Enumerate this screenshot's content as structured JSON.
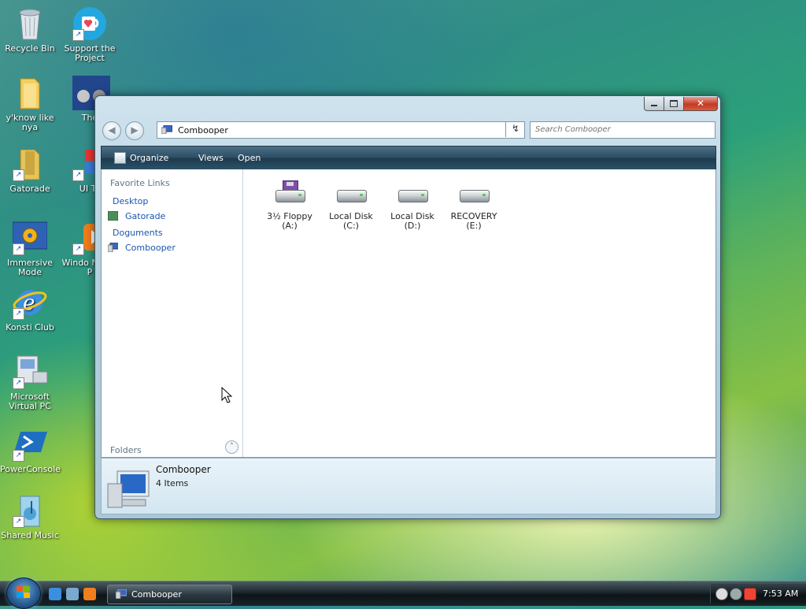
{
  "desktop": {
    "icons": [
      {
        "label": "Recycle Bin",
        "icon": "recycle-bin-icon"
      },
      {
        "label": "Support the Project",
        "icon": "heart-mug-icon"
      },
      {
        "label": "y'know like nya",
        "icon": "folder-icon"
      },
      {
        "label": "The",
        "icon": "cat-image-icon"
      },
      {
        "label": "Gatorade",
        "icon": "shortcut-icon"
      },
      {
        "label": "UI Te",
        "icon": "shortcut-icon"
      },
      {
        "label": "Immersive Mode",
        "icon": "settings-gear-icon"
      },
      {
        "label": "Windo Media P",
        "icon": "media-player-icon"
      },
      {
        "label": "Konsti Club",
        "icon": "internet-explorer-icon"
      },
      {
        "label": "Microsoft Virtual PC",
        "icon": "virtual-pc-icon"
      },
      {
        "label": "PowerConsole",
        "icon": "powershell-icon"
      },
      {
        "label": "Shared Music",
        "icon": "music-folder-icon"
      }
    ]
  },
  "window": {
    "address": "Combooper",
    "search_placeholder": "Search Combooper",
    "toolbar": {
      "organize": "Organize",
      "views": "Views",
      "open": "Open"
    },
    "nav": {
      "header": "Favorite Links",
      "links": [
        {
          "label": "Desktop"
        },
        {
          "label": "Gatorade"
        },
        {
          "label": "Doguments"
        },
        {
          "label": "Combooper"
        }
      ],
      "folders": "Folders"
    },
    "drives": [
      {
        "name": "3½ Floppy",
        "letter": "(A:)",
        "icon": "floppy-drive-icon"
      },
      {
        "name": "Local Disk",
        "letter": "(C:)",
        "icon": "hard-disk-icon"
      },
      {
        "name": "Local Disk",
        "letter": "(D:)",
        "icon": "hard-disk-icon"
      },
      {
        "name": "RECOVERY",
        "letter": "(E:)",
        "icon": "hard-disk-icon"
      }
    ],
    "details": {
      "name": "Combooper",
      "count": "4 Items"
    }
  },
  "taskbar": {
    "task_label": "Combooper",
    "clock": "7:53 AM"
  },
  "colors": {
    "accent": "#1a55b0",
    "toolbar": "#2d4e64",
    "close": "#c23a23"
  }
}
